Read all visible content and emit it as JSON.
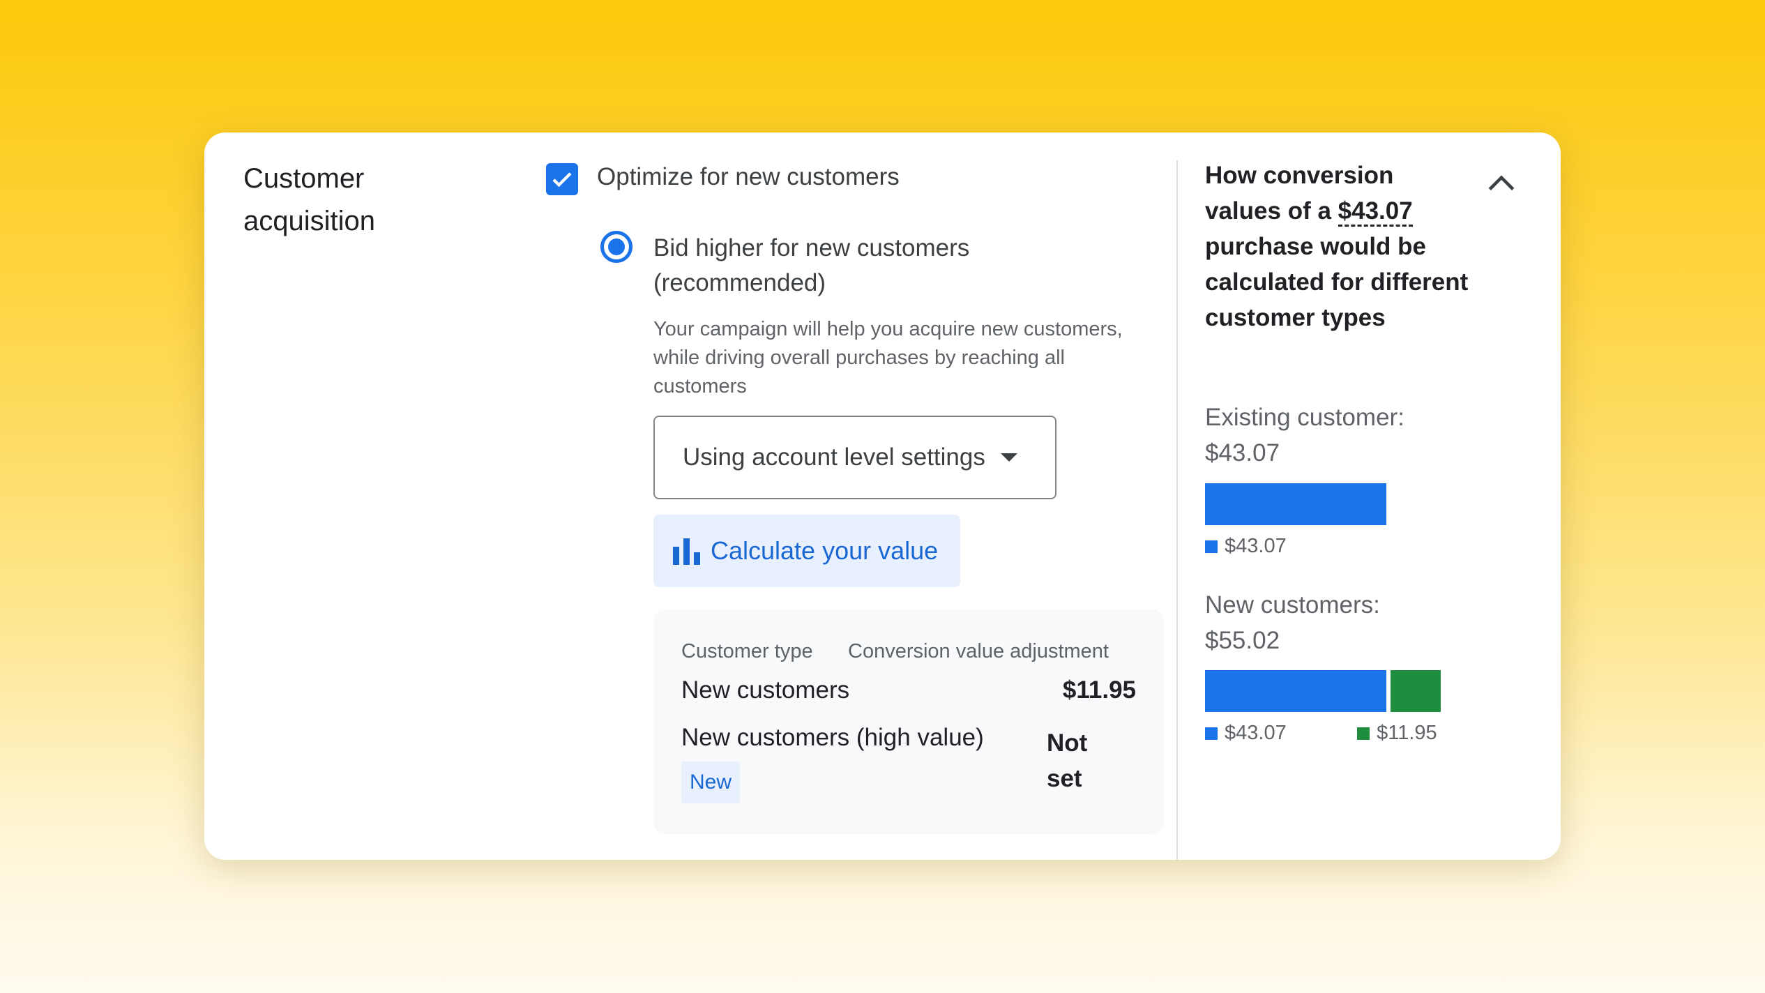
{
  "section": {
    "title": "Customer acquisition"
  },
  "optimize": {
    "label": "Optimize for new customers",
    "checked": true
  },
  "bid": {
    "label": "Bid higher for new customers (recommended)",
    "selected": true,
    "description": "Your campaign will help you acquire new customers, while driving overall purchases by reaching all customers"
  },
  "settings_dropdown": {
    "value": "Using account level settings"
  },
  "calculate_button": {
    "label": "Calculate your value",
    "icon": "bar-chart-icon"
  },
  "adjustment_table": {
    "headers": [
      "Customer type",
      "Conversion value adjustment"
    ],
    "rows": [
      {
        "type": "New customers",
        "value": "$11.95"
      },
      {
        "type": "New customers (high value)",
        "value": "Not set",
        "badge": "New"
      }
    ]
  },
  "explanation": {
    "title_prefix": "How conversion values of a ",
    "amount": "$43.07",
    "title_suffix": " purchase would be calculated for different customer types",
    "collapse_icon": "chevron-up-icon"
  },
  "chart_data": {
    "type": "bar",
    "groups": [
      {
        "label": "Existing customer:",
        "total": "$43.07",
        "segments": [
          {
            "value": 43.07,
            "label": "$43.07",
            "color": "#1a73e8"
          }
        ]
      },
      {
        "label": "New customers:",
        "total": "$55.02",
        "segments": [
          {
            "value": 43.07,
            "label": "$43.07",
            "color": "#1a73e8"
          },
          {
            "value": 11.95,
            "label": "$11.95",
            "color": "#1e8e3e"
          }
        ]
      }
    ]
  },
  "colors": {
    "primary": "#1a73e8",
    "secondary": "#1e8e3e",
    "badge_bg": "#e8f0fe"
  }
}
